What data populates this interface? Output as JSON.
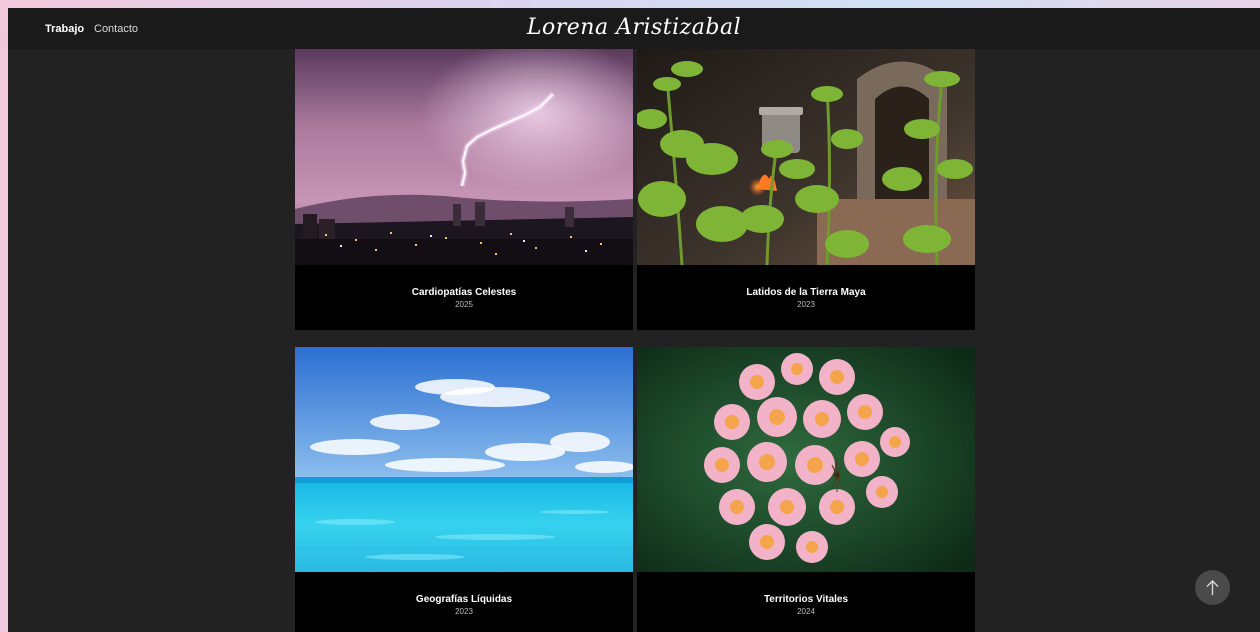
{
  "nav": {
    "items": [
      {
        "label": "Trabajo"
      },
      {
        "label": "Contacto"
      }
    ]
  },
  "brand": {
    "logo_text": "Lorena Aristizabal"
  },
  "projects": [
    {
      "title": "Cardiopatías Celestes",
      "year": "2025",
      "photo_icon": "lightning-city-photo"
    },
    {
      "title": "Latidos de la Tierra Maya",
      "year": "2023",
      "photo_icon": "plant-kitchen-photo"
    },
    {
      "title": "Geografías Líquidas",
      "year": "2023",
      "photo_icon": "ocean-sky-photo"
    },
    {
      "title": "Territorios Vitales",
      "year": "2024",
      "photo_icon": "flower-cluster-photo"
    }
  ],
  "scroll_top": {
    "icon": "arrow-up-icon"
  },
  "colors": {
    "frame_bg": "#222222",
    "topbar_bg": "#1a1a1a",
    "card_bg": "#000000",
    "text": "#ffffff",
    "scroll_button": "#4a4a4a"
  }
}
